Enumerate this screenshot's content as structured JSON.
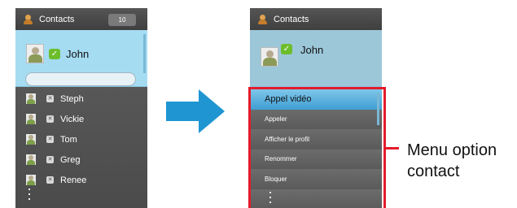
{
  "left_panel": {
    "header_title": "Contacts",
    "count_badge": "10",
    "selected_contact": "John",
    "contacts": [
      "Steph",
      "Vickie",
      "Tom",
      "Greg",
      "Renee"
    ]
  },
  "right_panel": {
    "header_title": "Contacts",
    "selected_contact": "John",
    "menu_items": [
      "Appel vidéo",
      "Appeler",
      "Afficher le profil",
      "Renommer",
      "Bloquer"
    ],
    "active_item": "Appel vidéo"
  },
  "annotation": {
    "line1": "Menu option",
    "line2": "contact"
  },
  "colors": {
    "arrow": "#1f95d1",
    "highlight_frame": "#e31b2a",
    "selected_row": "#a6dcf2",
    "status_online": "#6dbd2c"
  }
}
